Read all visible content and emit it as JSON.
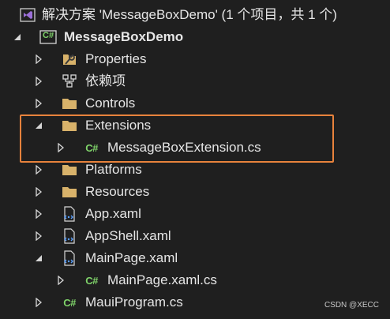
{
  "solution": {
    "label": "解决方案 'MessageBoxDemo' (1 个项目，共 1 个)",
    "icon": "visual-studio-solution-icon"
  },
  "project": {
    "label": "MessageBoxDemo",
    "badge": "C#",
    "icon": "csharp-project-icon"
  },
  "items": [
    {
      "label": "Properties",
      "icon": "wrench-folder-icon",
      "expander": "collapsed"
    },
    {
      "label": "依赖项",
      "icon": "dependencies-icon",
      "expander": "collapsed"
    },
    {
      "label": "Controls",
      "icon": "folder-icon",
      "expander": "collapsed"
    },
    {
      "label": "Extensions",
      "icon": "folder-icon",
      "expander": "expanded"
    },
    {
      "label": "MessageBoxExtension.cs",
      "icon": "csharp-file-icon",
      "expander": "collapsed",
      "badge": "C#"
    },
    {
      "label": "Platforms",
      "icon": "folder-icon",
      "expander": "collapsed"
    },
    {
      "label": "Resources",
      "icon": "folder-icon",
      "expander": "collapsed"
    },
    {
      "label": "App.xaml",
      "icon": "xaml-file-icon",
      "expander": "collapsed"
    },
    {
      "label": "AppShell.xaml",
      "icon": "xaml-file-icon",
      "expander": "collapsed"
    },
    {
      "label": "MainPage.xaml",
      "icon": "xaml-file-icon",
      "expander": "expanded"
    },
    {
      "label": "MainPage.xaml.cs",
      "icon": "csharp-file-icon",
      "expander": "collapsed",
      "badge": "C#"
    },
    {
      "label": "MauiProgram.cs",
      "icon": "csharp-file-icon",
      "expander": "none",
      "badge": "C#"
    }
  ],
  "watermark": "CSDN @XECC",
  "colors": {
    "background": "#1f1f1f",
    "highlight": "#e8823c",
    "folder": "#d8b26a",
    "csharp": "#7fd36a",
    "vs_purple": "#9b6fd8"
  }
}
